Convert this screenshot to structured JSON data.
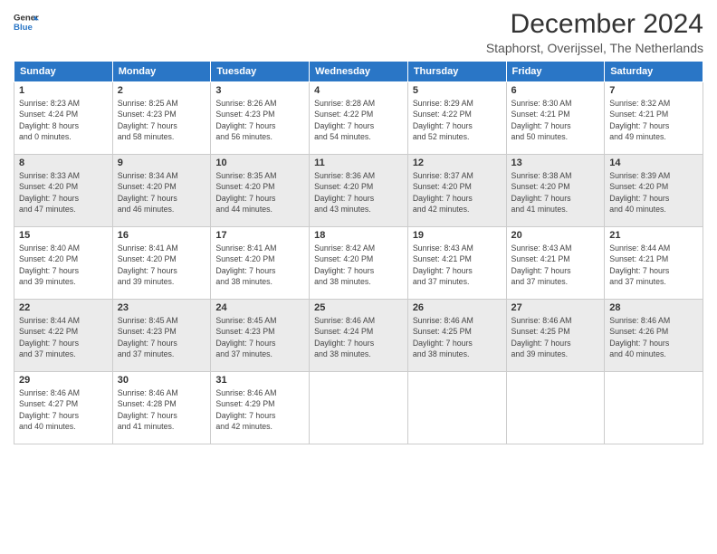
{
  "header": {
    "logo_line1": "General",
    "logo_line2": "Blue",
    "title": "December 2024",
    "subtitle": "Staphorst, Overijssel, The Netherlands"
  },
  "days_of_week": [
    "Sunday",
    "Monday",
    "Tuesday",
    "Wednesday",
    "Thursday",
    "Friday",
    "Saturday"
  ],
  "weeks": [
    [
      {
        "day": "1",
        "sunrise": "8:23 AM",
        "sunset": "4:24 PM",
        "daylight": "8 hours and 0 minutes."
      },
      {
        "day": "2",
        "sunrise": "8:25 AM",
        "sunset": "4:23 PM",
        "daylight": "7 hours and 58 minutes."
      },
      {
        "day": "3",
        "sunrise": "8:26 AM",
        "sunset": "4:23 PM",
        "daylight": "7 hours and 56 minutes."
      },
      {
        "day": "4",
        "sunrise": "8:28 AM",
        "sunset": "4:22 PM",
        "daylight": "7 hours and 54 minutes."
      },
      {
        "day": "5",
        "sunrise": "8:29 AM",
        "sunset": "4:22 PM",
        "daylight": "7 hours and 52 minutes."
      },
      {
        "day": "6",
        "sunrise": "8:30 AM",
        "sunset": "4:21 PM",
        "daylight": "7 hours and 50 minutes."
      },
      {
        "day": "7",
        "sunrise": "8:32 AM",
        "sunset": "4:21 PM",
        "daylight": "7 hours and 49 minutes."
      }
    ],
    [
      {
        "day": "8",
        "sunrise": "8:33 AM",
        "sunset": "4:20 PM",
        "daylight": "7 hours and 47 minutes."
      },
      {
        "day": "9",
        "sunrise": "8:34 AM",
        "sunset": "4:20 PM",
        "daylight": "7 hours and 46 minutes."
      },
      {
        "day": "10",
        "sunrise": "8:35 AM",
        "sunset": "4:20 PM",
        "daylight": "7 hours and 44 minutes."
      },
      {
        "day": "11",
        "sunrise": "8:36 AM",
        "sunset": "4:20 PM",
        "daylight": "7 hours and 43 minutes."
      },
      {
        "day": "12",
        "sunrise": "8:37 AM",
        "sunset": "4:20 PM",
        "daylight": "7 hours and 42 minutes."
      },
      {
        "day": "13",
        "sunrise": "8:38 AM",
        "sunset": "4:20 PM",
        "daylight": "7 hours and 41 minutes."
      },
      {
        "day": "14",
        "sunrise": "8:39 AM",
        "sunset": "4:20 PM",
        "daylight": "7 hours and 40 minutes."
      }
    ],
    [
      {
        "day": "15",
        "sunrise": "8:40 AM",
        "sunset": "4:20 PM",
        "daylight": "7 hours and 39 minutes."
      },
      {
        "day": "16",
        "sunrise": "8:41 AM",
        "sunset": "4:20 PM",
        "daylight": "7 hours and 39 minutes."
      },
      {
        "day": "17",
        "sunrise": "8:41 AM",
        "sunset": "4:20 PM",
        "daylight": "7 hours and 38 minutes."
      },
      {
        "day": "18",
        "sunrise": "8:42 AM",
        "sunset": "4:20 PM",
        "daylight": "7 hours and 38 minutes."
      },
      {
        "day": "19",
        "sunrise": "8:43 AM",
        "sunset": "4:21 PM",
        "daylight": "7 hours and 37 minutes."
      },
      {
        "day": "20",
        "sunrise": "8:43 AM",
        "sunset": "4:21 PM",
        "daylight": "7 hours and 37 minutes."
      },
      {
        "day": "21",
        "sunrise": "8:44 AM",
        "sunset": "4:21 PM",
        "daylight": "7 hours and 37 minutes."
      }
    ],
    [
      {
        "day": "22",
        "sunrise": "8:44 AM",
        "sunset": "4:22 PM",
        "daylight": "7 hours and 37 minutes."
      },
      {
        "day": "23",
        "sunrise": "8:45 AM",
        "sunset": "4:23 PM",
        "daylight": "7 hours and 37 minutes."
      },
      {
        "day": "24",
        "sunrise": "8:45 AM",
        "sunset": "4:23 PM",
        "daylight": "7 hours and 37 minutes."
      },
      {
        "day": "25",
        "sunrise": "8:46 AM",
        "sunset": "4:24 PM",
        "daylight": "7 hours and 38 minutes."
      },
      {
        "day": "26",
        "sunrise": "8:46 AM",
        "sunset": "4:25 PM",
        "daylight": "7 hours and 38 minutes."
      },
      {
        "day": "27",
        "sunrise": "8:46 AM",
        "sunset": "4:25 PM",
        "daylight": "7 hours and 39 minutes."
      },
      {
        "day": "28",
        "sunrise": "8:46 AM",
        "sunset": "4:26 PM",
        "daylight": "7 hours and 40 minutes."
      }
    ],
    [
      {
        "day": "29",
        "sunrise": "8:46 AM",
        "sunset": "4:27 PM",
        "daylight": "7 hours and 40 minutes."
      },
      {
        "day": "30",
        "sunrise": "8:46 AM",
        "sunset": "4:28 PM",
        "daylight": "7 hours and 41 minutes."
      },
      {
        "day": "31",
        "sunrise": "8:46 AM",
        "sunset": "4:29 PM",
        "daylight": "7 hours and 42 minutes."
      },
      null,
      null,
      null,
      null
    ]
  ],
  "labels": {
    "sunrise": "Sunrise:",
    "sunset": "Sunset:",
    "daylight": "Daylight hours"
  }
}
